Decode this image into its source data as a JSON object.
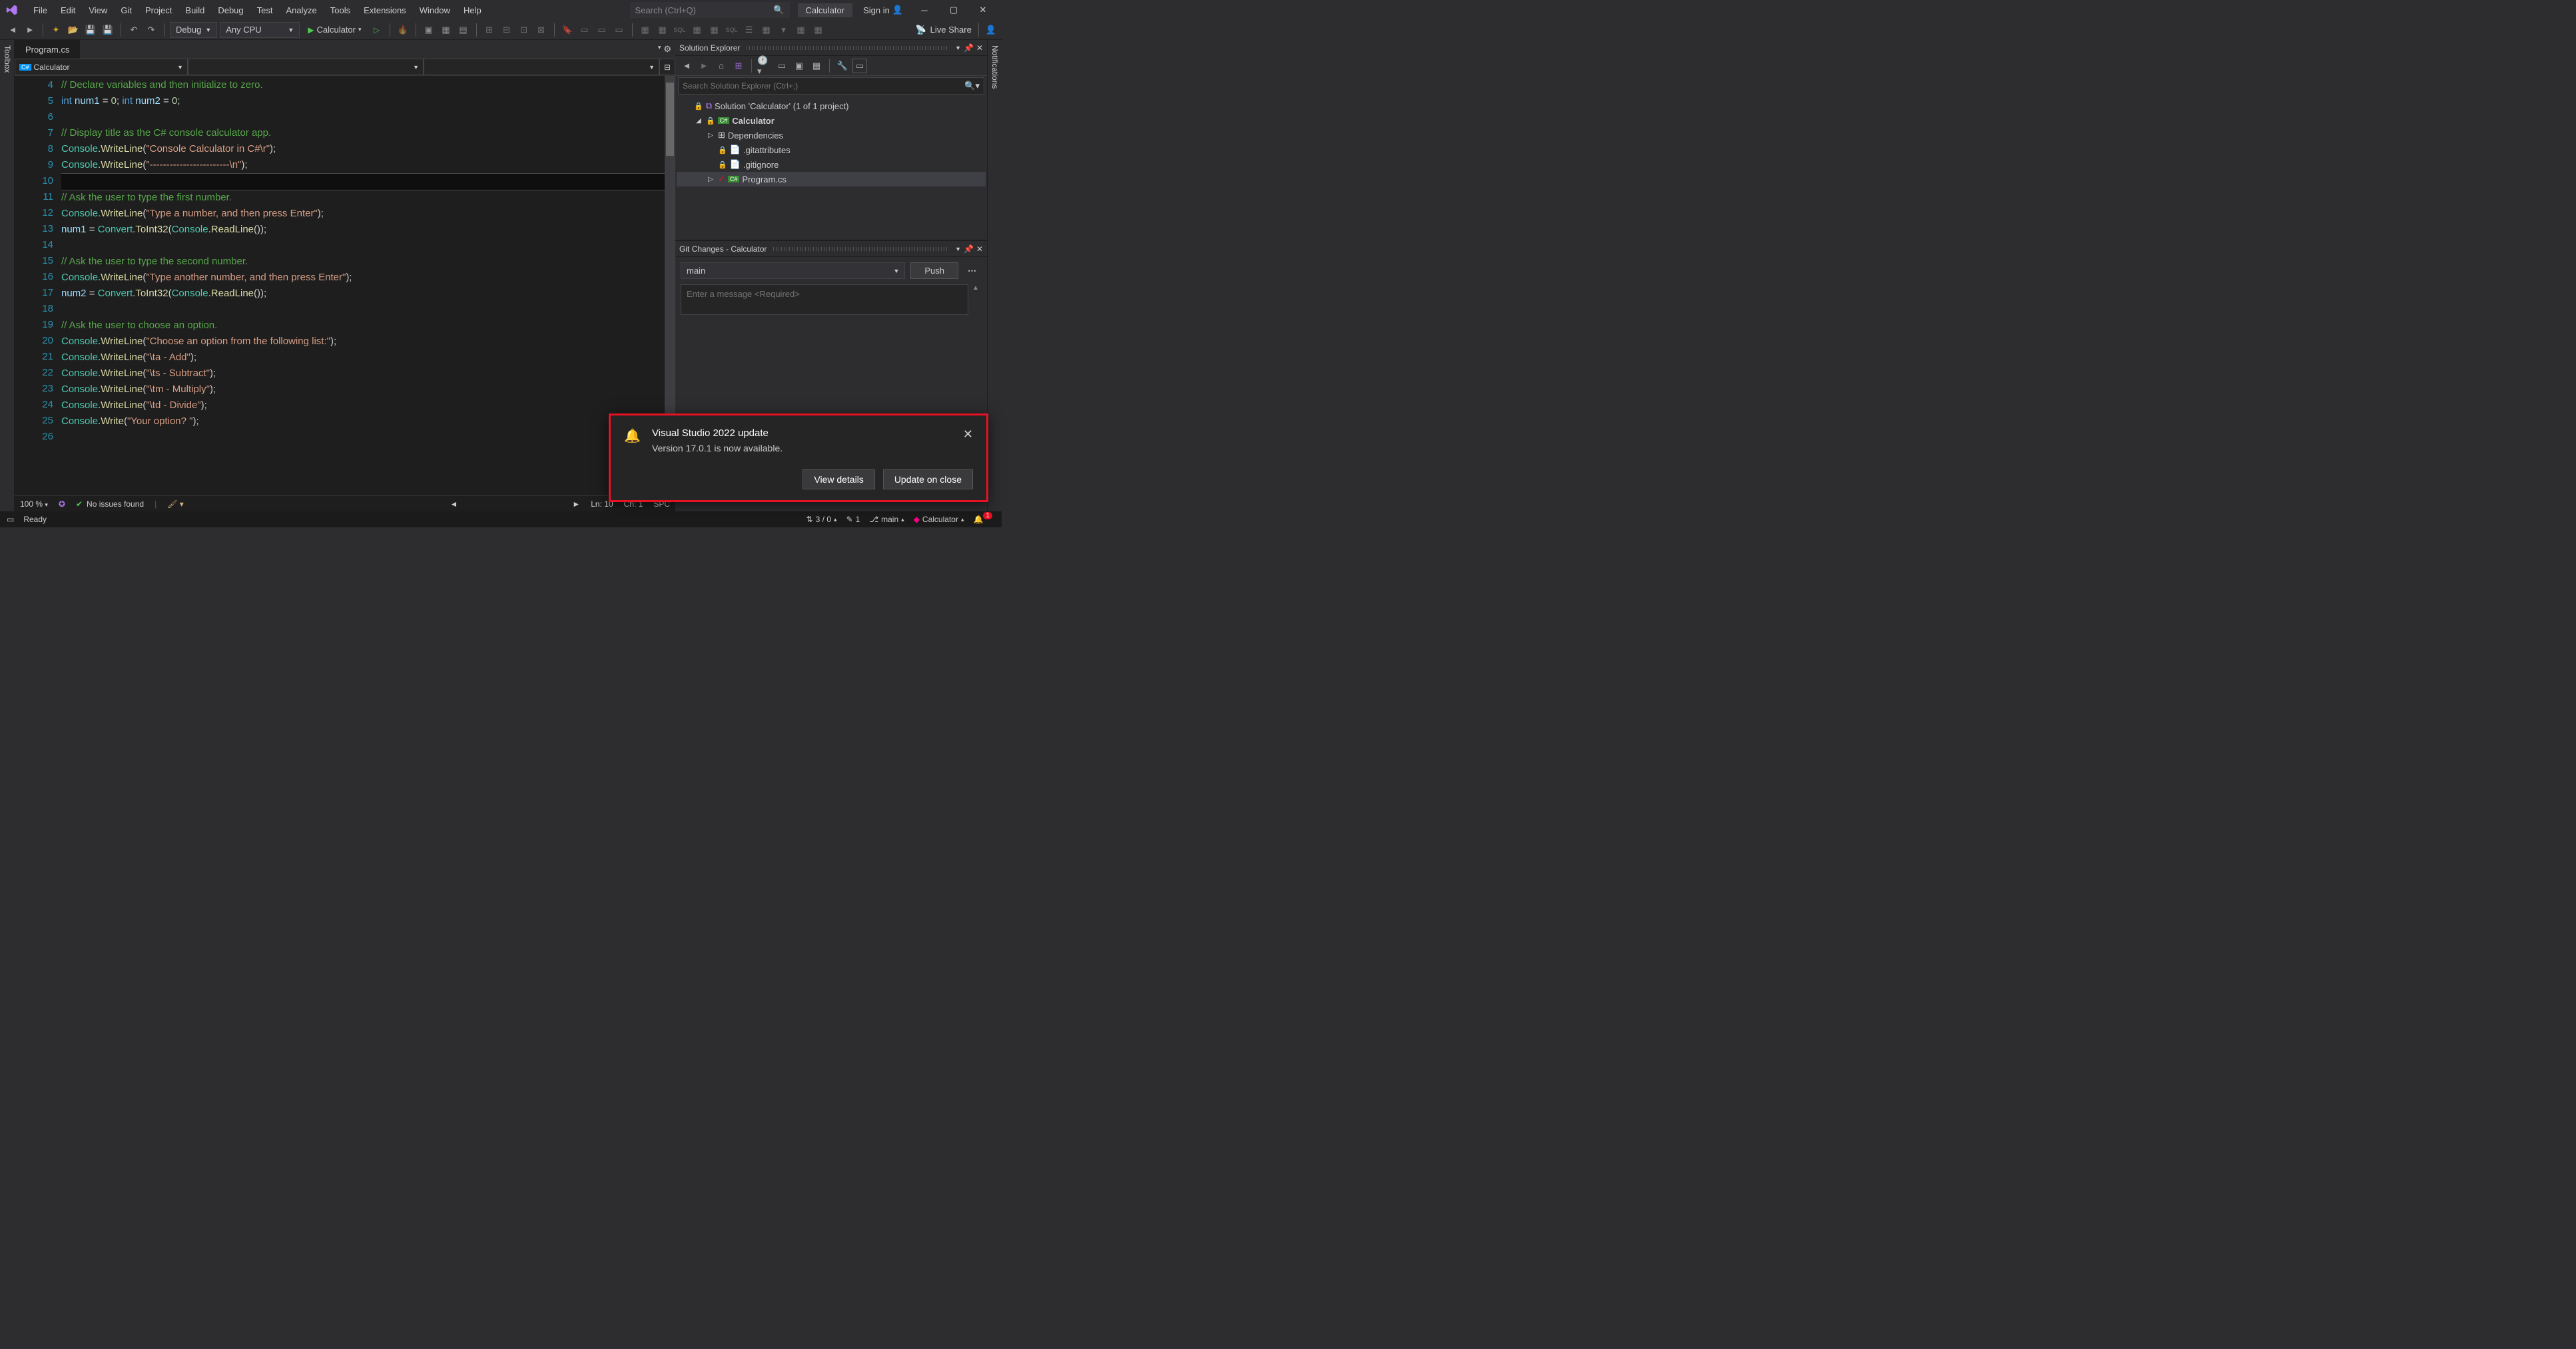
{
  "menu": [
    "File",
    "Edit",
    "View",
    "Git",
    "Project",
    "Build",
    "Debug",
    "Test",
    "Analyze",
    "Tools",
    "Extensions",
    "Window",
    "Help"
  ],
  "search_placeholder": "Search (Ctrl+Q)",
  "app_name": "Calculator",
  "signin": "Sign in",
  "toolbar": {
    "config": "Debug",
    "platform": "Any CPU",
    "start": "Calculator",
    "live_share": "Live Share"
  },
  "toolbox_tab": "Toolbox",
  "notifications_tab": "Notifications",
  "file_tab": "Program.cs",
  "nav_combo": "Calculator",
  "nav_type_glyph": "C#",
  "code_lines": [
    {
      "n": 4,
      "t": "comment",
      "text": "// Declare variables and then initialize to zero."
    },
    {
      "n": 5,
      "t": "code",
      "html": "<span class='c-keyword'>int</span> <span class='c-ident'>num1</span> = <span class='c-num'>0</span>; <span class='c-keyword'>int</span> <span class='c-ident'>num2</span> = <span class='c-num'>0</span>;"
    },
    {
      "n": 6,
      "t": "blank",
      "text": ""
    },
    {
      "n": 7,
      "t": "comment",
      "text": "// Display title as the C# console calculator app."
    },
    {
      "n": 8,
      "t": "code",
      "html": "<span class='c-type'>Console</span>.<span class='c-method'>WriteLine</span>(<span class='c-string'>\"Console Calculator in C#\\r\"</span>);"
    },
    {
      "n": 9,
      "t": "code",
      "html": "<span class='c-type'>Console</span>.<span class='c-method'>WriteLine</span>(<span class='c-string'>\"------------------------\\n\"</span>);"
    },
    {
      "n": 10,
      "t": "current",
      "text": ""
    },
    {
      "n": 11,
      "t": "comment",
      "text": "// Ask the user to type the first number."
    },
    {
      "n": 12,
      "t": "code",
      "html": "<span class='c-type'>Console</span>.<span class='c-method'>WriteLine</span>(<span class='c-string'>\"Type a number, and then press Enter\"</span>);"
    },
    {
      "n": 13,
      "t": "code",
      "html": "<span class='c-ident'>num1</span> = <span class='c-type'>Convert</span>.<span class='c-method'>ToInt32</span>(<span class='c-type'>Console</span>.<span class='c-method'>ReadLine</span>());"
    },
    {
      "n": 14,
      "t": "blank",
      "text": ""
    },
    {
      "n": 15,
      "t": "comment",
      "text": "// Ask the user to type the second number."
    },
    {
      "n": 16,
      "t": "code",
      "html": "<span class='c-type'>Console</span>.<span class='c-method'>WriteLine</span>(<span class='c-string'>\"Type another number, and then press Enter\"</span>);"
    },
    {
      "n": 17,
      "t": "code",
      "html": "<span class='c-ident'>num2</span> = <span class='c-type'>Convert</span>.<span class='c-method'>ToInt32</span>(<span class='c-type'>Console</span>.<span class='c-method'>ReadLine</span>());"
    },
    {
      "n": 18,
      "t": "blank",
      "text": ""
    },
    {
      "n": 19,
      "t": "comment",
      "text": "// Ask the user to choose an option."
    },
    {
      "n": 20,
      "t": "code",
      "html": "<span class='c-type'>Console</span>.<span class='c-method'>WriteLine</span>(<span class='c-string'>\"Choose an option from the following list:\"</span>);"
    },
    {
      "n": 21,
      "t": "code",
      "html": "<span class='c-type'>Console</span>.<span class='c-method'>WriteLine</span>(<span class='c-string'>\"\\ta - Add\"</span>);"
    },
    {
      "n": 22,
      "t": "code",
      "html": "<span class='c-type'>Console</span>.<span class='c-method'>WriteLine</span>(<span class='c-string'>\"\\ts - Subtract\"</span>);"
    },
    {
      "n": 23,
      "t": "code",
      "html": "<span class='c-type'>Console</span>.<span class='c-method'>WriteLine</span>(<span class='c-string'>\"\\tm - Multiply\"</span>);"
    },
    {
      "n": 24,
      "t": "code",
      "html": "<span class='c-type'>Console</span>.<span class='c-method'>WriteLine</span>(<span class='c-string'>\"\\td - Divide\"</span>);"
    },
    {
      "n": 25,
      "t": "code",
      "html": "<span class='c-type'>Console</span>.<span class='c-method'>Write</span>(<span class='c-string'>\"Your option? \"</span>);"
    },
    {
      "n": 26,
      "t": "blank",
      "text": ""
    }
  ],
  "editor_status": {
    "zoom": "100 %",
    "issues": "No issues found",
    "ln": "Ln: 10",
    "ch": "Ch: 1",
    "enc": "SPC"
  },
  "solution_explorer": {
    "title": "Solution Explorer",
    "search_placeholder": "Search Solution Explorer (Ctrl+;)",
    "tree": [
      {
        "depth": 0,
        "icon": "solution",
        "label": "Solution 'Calculator' (1 of 1 project)",
        "lock": true,
        "expander": "none"
      },
      {
        "depth": 1,
        "icon": "csproj",
        "label": "Calculator",
        "lock": true,
        "expander": "open",
        "bold": true
      },
      {
        "depth": 2,
        "icon": "deps",
        "label": "Dependencies",
        "expander": "closed"
      },
      {
        "depth": 2,
        "icon": "file",
        "label": ".gitattributes",
        "lock": true
      },
      {
        "depth": 2,
        "icon": "file",
        "label": ".gitignore",
        "lock": true
      },
      {
        "depth": 2,
        "icon": "csfile",
        "label": "Program.cs",
        "expander": "closed",
        "selected": true,
        "check": true
      }
    ]
  },
  "git_changes": {
    "title": "Git Changes - Calculator",
    "branch": "main",
    "push": "Push",
    "msg_placeholder": "Enter a message <Required>"
  },
  "toast": {
    "title": "Visual Studio 2022 update",
    "msg": "Version 17.0.1 is now available.",
    "btn1": "View details",
    "btn2": "Update on close"
  },
  "statusbar": {
    "ready": "Ready",
    "changes": "3 / 0",
    "pending": "1",
    "branch": "main",
    "repo": "Calculator",
    "notif_count": "1"
  }
}
